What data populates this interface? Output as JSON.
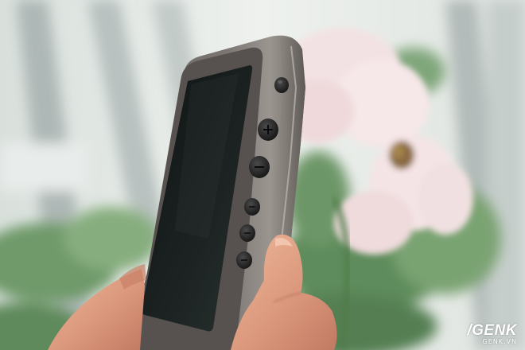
{
  "photo": {
    "subject": "hand-holding-digital-audio-player",
    "colors": {
      "background_light": "#e9ede9",
      "background_green": "#6f9a6a",
      "flower_pink": "#f2dfe0",
      "device_body": "#5c5a58",
      "device_edge": "#8d8985",
      "screen": "#1b2120",
      "button": "#262626",
      "skin": "#e2a588"
    }
  },
  "watermark": {
    "brand": "/GENK",
    "site": "GENK.VN"
  }
}
